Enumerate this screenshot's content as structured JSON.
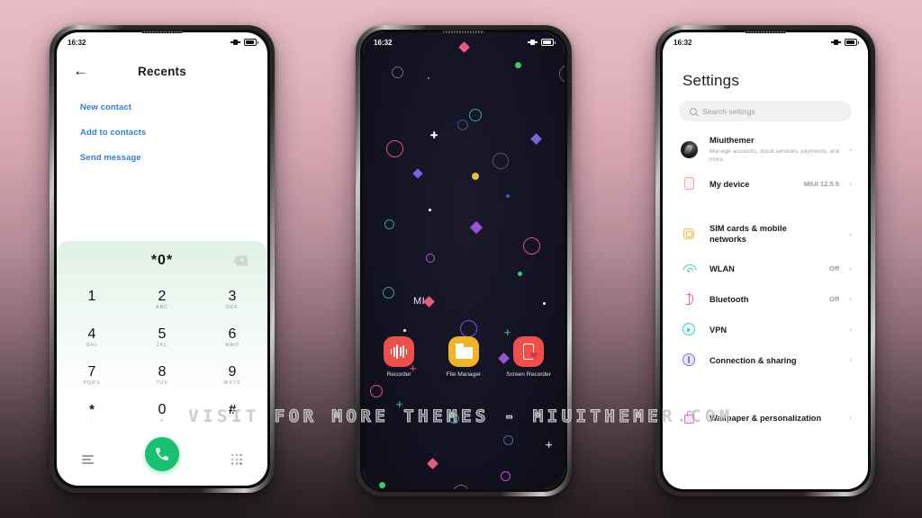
{
  "watermark": "VISIT FOR MORE THEMES - MIUITHEMER.COM",
  "phone1": {
    "statusbar": {
      "time": "16:32",
      "vibrate_icon": "vibrate-icon",
      "battery_icon": "battery-icon"
    },
    "header": {
      "back_icon": "back-arrow-icon",
      "title": "Recents"
    },
    "links": [
      {
        "label": "New contact"
      },
      {
        "label": "Add to contacts"
      },
      {
        "label": "Send message"
      }
    ],
    "dialer": {
      "number": "*0*",
      "backspace_icon": "backspace-icon",
      "keys": [
        {
          "num": "1",
          "sub": ""
        },
        {
          "num": "2",
          "sub": "ABC"
        },
        {
          "num": "3",
          "sub": "DEF"
        },
        {
          "num": "4",
          "sub": "GHI"
        },
        {
          "num": "5",
          "sub": "JKL"
        },
        {
          "num": "6",
          "sub": "MNO"
        },
        {
          "num": "7",
          "sub": "PQRS"
        },
        {
          "num": "8",
          "sub": "TUV"
        },
        {
          "num": "9",
          "sub": "WXYZ"
        },
        {
          "num": "*",
          "sub": ","
        },
        {
          "num": "0",
          "sub": "+"
        },
        {
          "num": "#",
          "sub": ""
        }
      ],
      "menu_icon": "list-menu-icon",
      "call_icon": "call-icon",
      "keypad_icon": "keypad-grid-icon",
      "call_button_color": "#19c271"
    }
  },
  "phone2": {
    "statusbar": {
      "time": "16:32",
      "vibrate_icon": "vibrate-icon",
      "battery_icon": "battery-icon"
    },
    "widget": {
      "text": "MI",
      "accent_color": "#e8597e"
    },
    "apps": [
      {
        "label": "Recorder",
        "icon": "recorder-icon",
        "color": "#ef4f4a"
      },
      {
        "label": "File Manager",
        "icon": "file-manager-icon",
        "color": "#f0b429"
      },
      {
        "label": "Screen Recorder",
        "icon": "screen-recorder-icon",
        "color": "#ef4f4a"
      }
    ]
  },
  "phone3": {
    "statusbar": {
      "time": "16:32",
      "vibrate_icon": "vibrate-icon",
      "battery_icon": "battery-icon"
    },
    "title": "Settings",
    "search": {
      "placeholder": "Search settings",
      "icon": "search-icon"
    },
    "account": {
      "name": "Miuithemer",
      "subtitle": "Manage accounts, cloud services, payments, and more",
      "avatar": "account-avatar",
      "chevron": "›"
    },
    "items": [
      {
        "label": "My device",
        "value": "MIUI 12.5.5",
        "icon": "device-icon",
        "chevron": "›"
      },
      {
        "label": "SIM cards & mobile networks",
        "value": "",
        "icon": "sim-card-icon",
        "chevron": "›"
      },
      {
        "label": "WLAN",
        "value": "Off",
        "icon": "wifi-icon",
        "chevron": "›"
      },
      {
        "label": "Bluetooth",
        "value": "Off",
        "icon": "bluetooth-icon",
        "chevron": "›"
      },
      {
        "label": "VPN",
        "value": "",
        "icon": "vpn-icon",
        "chevron": "›"
      },
      {
        "label": "Connection & sharing",
        "value": "",
        "icon": "connection-icon",
        "chevron": "›"
      },
      {
        "label": "Wallpaper & personalization",
        "value": "",
        "icon": "wallpaper-icon",
        "chevron": "›"
      }
    ]
  }
}
